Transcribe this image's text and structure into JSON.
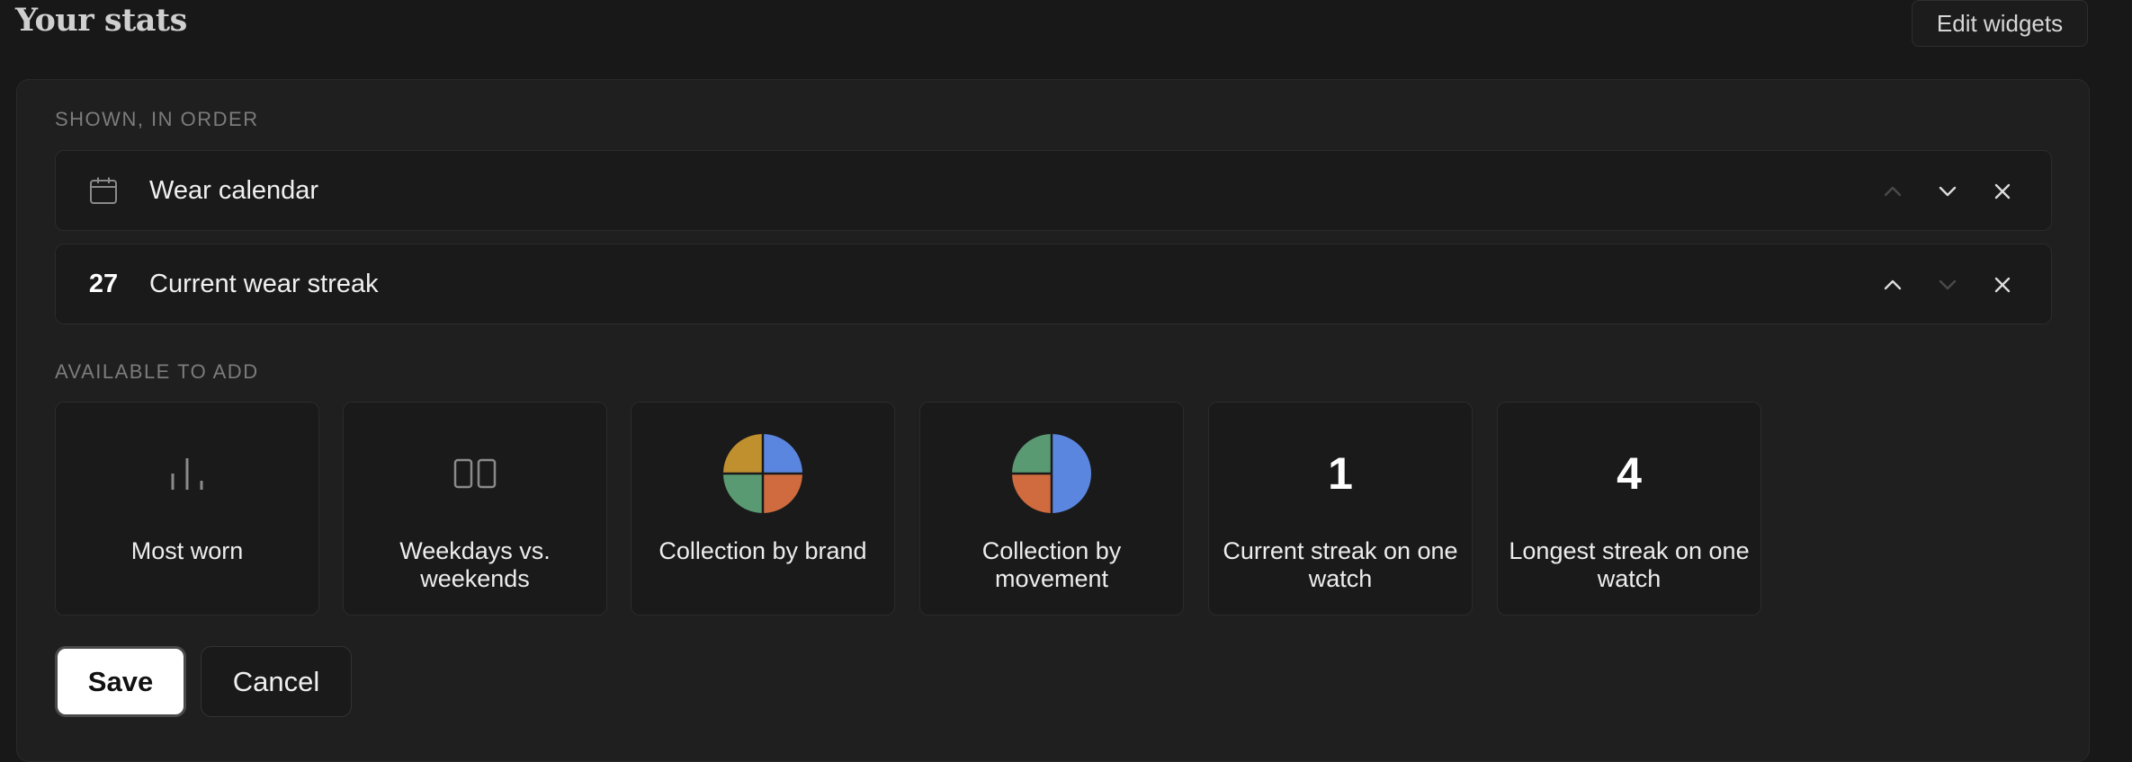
{
  "header": {
    "title": "Your stats",
    "edit_button": "Edit widgets"
  },
  "shown": {
    "section_label": "SHOWN, IN ORDER",
    "items": [
      {
        "icon": "calendar-icon",
        "label": "Wear calendar",
        "move_up_enabled": false,
        "move_down_enabled": true
      },
      {
        "lead_value": "27",
        "label": "Current wear streak",
        "move_up_enabled": true,
        "move_down_enabled": false
      }
    ]
  },
  "available": {
    "section_label": "AVAILABLE TO ADD",
    "tiles": [
      {
        "icon": "bar-chart-icon",
        "label": "Most worn"
      },
      {
        "icon": "columns-icon",
        "label": "Weekdays vs. weekends"
      },
      {
        "icon": "pie-chart-icon",
        "label": "Collection by brand"
      },
      {
        "icon": "pie-chart-icon",
        "label": "Collection by movement"
      },
      {
        "value": "1",
        "label": "Current streak on one watch"
      },
      {
        "value": "4",
        "label": "Longest streak on one watch"
      }
    ]
  },
  "actions": {
    "save": "Save",
    "cancel": "Cancel"
  },
  "colors": {
    "background": "#181818",
    "panel": "#1f1f1f",
    "pie_blue": "#5b86e0",
    "pie_orange": "#cf6b3e",
    "pie_green": "#5a9a72",
    "pie_gold": "#c1902e"
  }
}
